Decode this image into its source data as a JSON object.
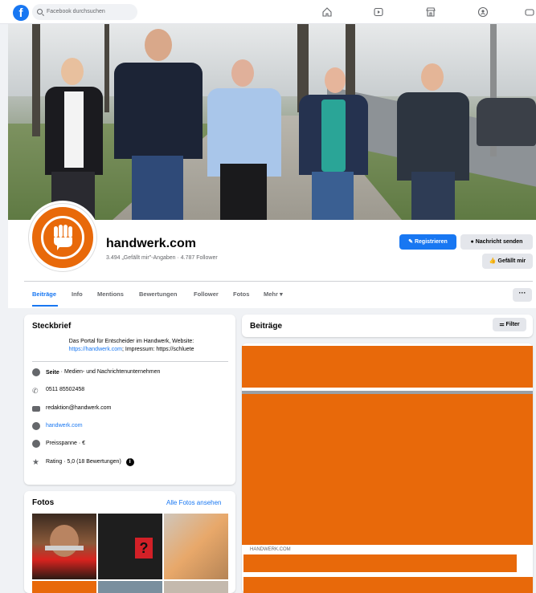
{
  "topbar": {
    "logo": "f",
    "search_placeholder": "Facebook durchsuchen",
    "nav_icons": [
      "home-icon",
      "watch-icon",
      "marketplace-icon",
      "groups-icon",
      "gaming-icon"
    ]
  },
  "page": {
    "name": "handwerk.com",
    "meta": "3.494 „Gefällt mir\"-Angaben · 4.787 Follower",
    "buttons": {
      "register": "Registrieren",
      "message": "Nachricht senden",
      "like": "Gefällt mir"
    }
  },
  "tabs": [
    {
      "label": "Beiträge",
      "active": true
    },
    {
      "label": "Info"
    },
    {
      "label": "Mentions"
    },
    {
      "label": "Bewertungen"
    },
    {
      "label": "Follower"
    },
    {
      "label": "Fotos"
    },
    {
      "label": "Mehr ▾"
    }
  ],
  "more_label": "···",
  "steckbrief": {
    "title": "Steckbrief",
    "intro_line1": "Das Portal für Entscheider im Handwerk, Website:",
    "intro_link": "https://handwerk.com",
    "intro_line2": "; Impressum: https://schluete",
    "rows": [
      {
        "icon": "info-icon",
        "bold": "Seite",
        "text": " · Medien- und Nachrichtenunternehmen"
      },
      {
        "icon": "phone-icon",
        "text": "0511 85502458"
      },
      {
        "icon": "email-icon",
        "text": "redaktion@handwerk.com"
      },
      {
        "icon": "globe-icon",
        "text": "handwerk.com",
        "link": true
      },
      {
        "icon": "price-icon",
        "text": "Preisspanne · €"
      },
      {
        "icon": "star-icon",
        "text": "Rating · 5,0 (18 Bewertungen)"
      }
    ]
  },
  "fotos": {
    "title": "Fotos",
    "all_link": "Alle Fotos ansehen"
  },
  "beitraege": {
    "title": "Beiträge",
    "filter": "Filter",
    "source": "HANDWERK.COM"
  },
  "colors": {
    "accent": "#1877f2",
    "brand_orange": "#e8690a",
    "background": "#f0f2f5"
  }
}
